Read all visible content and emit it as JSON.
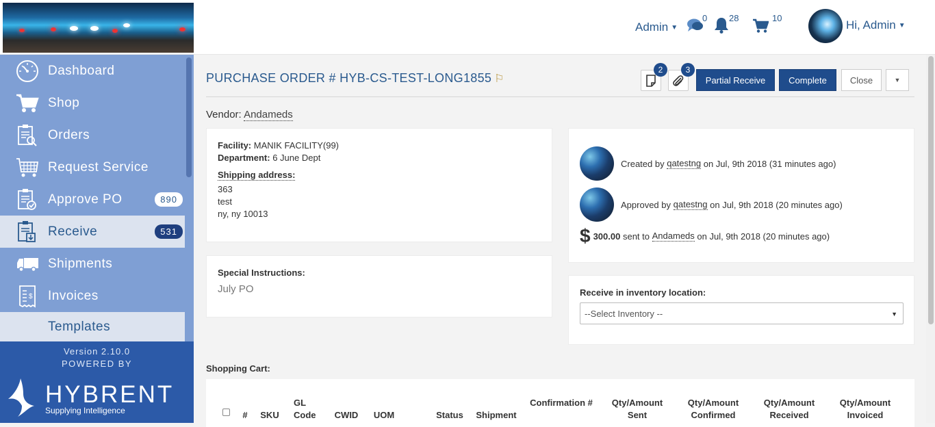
{
  "topbar": {
    "admin_menu": "Admin",
    "messages_count": "0",
    "notifications_count": "28",
    "cart_count": "10",
    "greeting": "Hi, Admin"
  },
  "sidebar": {
    "items": [
      {
        "label": "Dashboard",
        "icon": "dashboard-gauge-icon"
      },
      {
        "label": "Shop",
        "icon": "shopping-cart-icon"
      },
      {
        "label": "Orders",
        "icon": "orders-clipboard-search-icon"
      },
      {
        "label": "Request Service",
        "icon": "request-service-icon"
      },
      {
        "label": "Approve PO",
        "icon": "approve-clipboard-icon",
        "badge": "890"
      },
      {
        "label": "Receive",
        "icon": "receive-clipboard-icon",
        "badge": "531",
        "active": true
      },
      {
        "label": "Shipments",
        "icon": "truck-icon"
      },
      {
        "label": "Invoices",
        "icon": "invoice-icon"
      },
      {
        "label": "Templates",
        "icon": ""
      }
    ],
    "version": "Version 2.10.0",
    "powered_by": "POWERED BY",
    "brand": "HYBRENT",
    "tagline": "Supplying Intelligence"
  },
  "po": {
    "title": "PURCHASE ORDER # HYB-CS-TEST-LONG1855",
    "notes_count": "2",
    "attachments_count": "3",
    "partial_receive_label": "Partial Receive",
    "complete_label": "Complete",
    "close_label": "Close",
    "vendor_label": "Vendor:",
    "vendor_name": "Andameds"
  },
  "facility_card": {
    "facility_label": "Facility:",
    "facility_value": "MANIK FACILITY(99)",
    "department_label": "Department:",
    "department_value": "6 June Dept",
    "shipping_label": "Shipping address:",
    "address_line1": "363",
    "address_line2": "test",
    "address_line3": "ny, ny 10013"
  },
  "instructions_card": {
    "label": "Special Instructions:",
    "value": "July PO"
  },
  "activity": {
    "created_prefix": "Created by",
    "created_user": "qatestng",
    "created_suffix": "on Jul, 9th 2018 (31 minutes ago)",
    "approved_prefix": "Approved by",
    "approved_user": "qatestng",
    "approved_suffix": "on Jul, 9th 2018 (20 minutes ago)",
    "currency_symbol": "$",
    "amount": "300.00",
    "sent_to": "sent to",
    "sent_vendor": "Andameds",
    "sent_suffix": "on Jul, 9th 2018 (20 minutes ago)"
  },
  "inventory": {
    "label": "Receive in inventory location:",
    "selected": "--Select Inventory --"
  },
  "cart": {
    "label": "Shopping Cart:",
    "columns": [
      "#",
      "SKU",
      "GL Code",
      "CWID",
      "UOM",
      "Status",
      "Shipment",
      "Confirmation #",
      "Qty/Amount Sent",
      "Qty/Amount Confirmed",
      "Qty/Amount Received",
      "Qty/Amount Invoiced"
    ]
  }
}
